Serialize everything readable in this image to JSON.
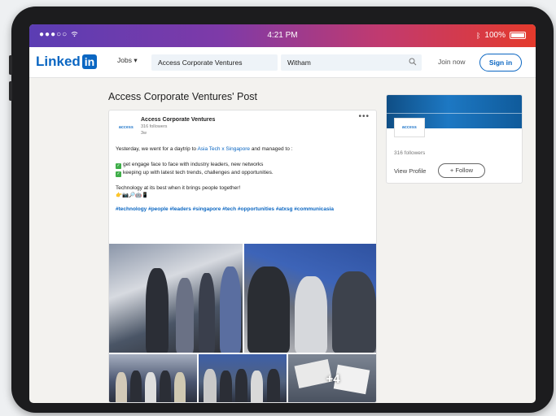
{
  "status_bar": {
    "carrier": "●●●○○",
    "wifi_icon": "wifi-icon",
    "time": "4:21 PM",
    "battery": "100%"
  },
  "nav": {
    "logo_text": "Linked",
    "logo_in": "in",
    "jobs_label": "Jobs ▾",
    "search_value": "Access Corporate Ventures",
    "location_value": "Witham",
    "join_label": "Join now",
    "signin_label": "Sign in"
  },
  "page_title": "Access Corporate Ventures' Post",
  "post": {
    "company": "Access Corporate Ventures",
    "logo_text": "access",
    "followers": "316 followers",
    "age": "3w",
    "more": "•••",
    "line1_pre": "Yesterday, we went for a daytrip to ",
    "line1_link": "Asia Tech x Singapore",
    "line1_post": " and managed to :",
    "bullets": [
      "get engage face to face with industry leaders, new networks",
      "keeping up with latest tech trends, challenges and opportunities."
    ],
    "closing": "Technology at its best when it brings people together!",
    "emojis": "👉📷🔎🤖📱",
    "hashtags": "#technology #people #leaders #singapore #tech #opportunities #atxsg #communicasia",
    "extra_photos": "+4"
  },
  "side_card": {
    "logo_text": "access",
    "followers": "316 followers",
    "view_profile": "View Profile",
    "follow_label": "+ Follow"
  }
}
